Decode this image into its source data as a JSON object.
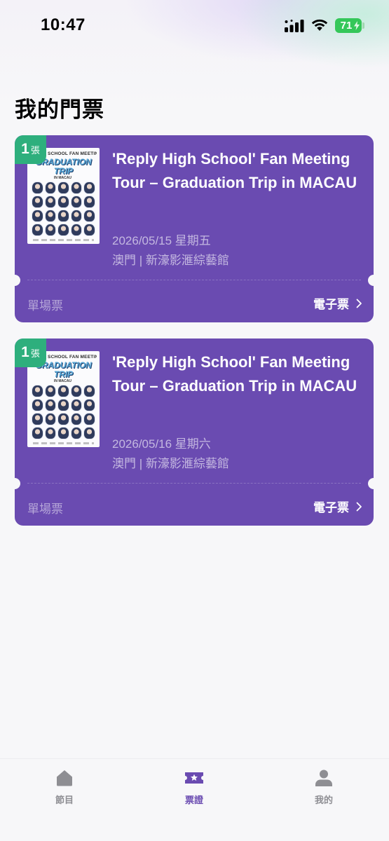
{
  "status_bar": {
    "time": "10:47",
    "battery_level": "71",
    "icons": [
      "signal-icon",
      "wifi-icon",
      "battery-icon"
    ]
  },
  "page": {
    "title": "我的門票"
  },
  "poster": {
    "header": "HIGH SCHOOL FAN MEETING TOUR",
    "logo_line1": "GRADUATION",
    "logo_line2": "TRIP",
    "sub": "IN MACAU"
  },
  "tickets": [
    {
      "quantity": "1",
      "quantity_unit": "張",
      "title": "'Reply High School' Fan Meeting Tour – Graduation Trip in MACAU",
      "date": "2026/05/15 星期五",
      "venue": "澳門 | 新濠影滙綜藝館",
      "ticket_type": "單場票",
      "action_label": "電子票"
    },
    {
      "quantity": "1",
      "quantity_unit": "張",
      "title": "'Reply High School' Fan Meeting Tour – Graduation Trip in MACAU",
      "date": "2026/05/16 星期六",
      "venue": "澳門 | 新濠影滙綜藝館",
      "ticket_type": "單場票",
      "action_label": "電子票"
    }
  ],
  "tab_bar": {
    "items": [
      {
        "label": "節目",
        "icon": "home-icon",
        "active": false
      },
      {
        "label": "票證",
        "icon": "ticket-icon",
        "active": true
      },
      {
        "label": "我的",
        "icon": "person-icon",
        "active": false
      }
    ]
  },
  "colors": {
    "ticket_bg": "#6a4bb1",
    "badge_bg": "#2eaf7d",
    "battery": "#34c759",
    "tab_active": "#6a4bb1",
    "tab_inactive": "#8e8e93"
  }
}
